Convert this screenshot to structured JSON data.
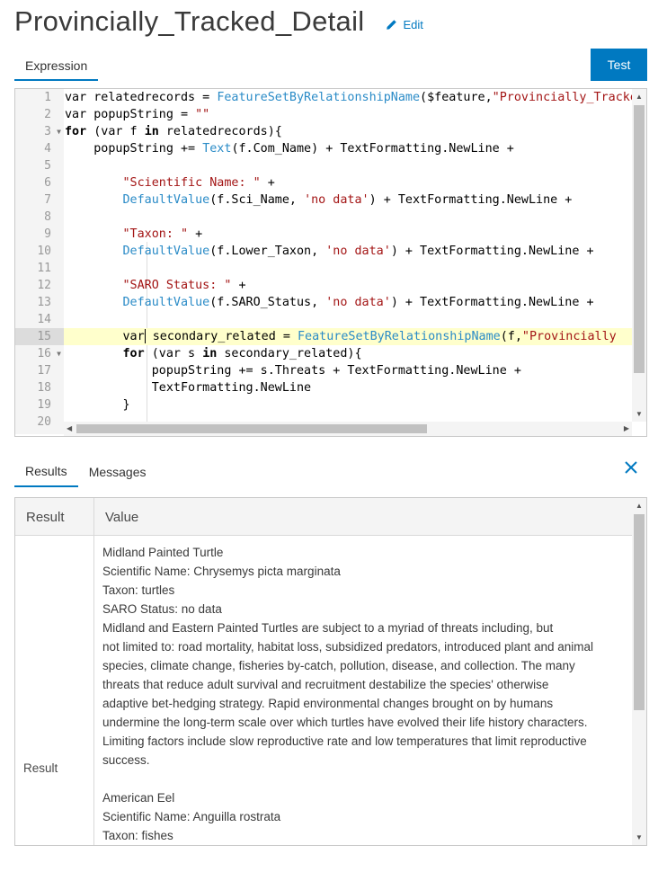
{
  "header": {
    "title": "Provincially_Tracked_Detail",
    "edit_label": "Edit"
  },
  "editor_tab": "Expression",
  "test_label": "Test",
  "code": {
    "line_numbers": [
      "1",
      "2",
      "3",
      "4",
      "5",
      "6",
      "7",
      "8",
      "9",
      "10",
      "11",
      "12",
      "13",
      "14",
      "15",
      "16",
      "17",
      "18",
      "19",
      "20"
    ],
    "active_line": 15
  },
  "bottom_tabs": [
    "Results",
    "Messages"
  ],
  "results": {
    "columns": [
      "Result",
      "Value"
    ],
    "row_label": "Result",
    "lines": [
      "Midland Painted Turtle",
      "Scientific Name: Chrysemys picta marginata",
      "Taxon: turtles",
      "SARO Status: no data",
      "Midland and Eastern Painted Turtles are subject to a myriad of threats including, but",
      "not limited to: road mortality, habitat loss, subsidized predators, introduced plant and animal",
      "species, climate change, fisheries by-catch, pollution, disease, and collection. The many",
      "threats that reduce adult survival and recruitment destabilize the species' otherwise",
      "adaptive bet-hedging strategy. Rapid environmental changes brought on by humans",
      "undermine the long-term scale over which turtles have evolved their life history characters.",
      "Limiting factors include slow reproductive rate and low temperatures that limit reproductive",
      "success.",
      "",
      "American Eel",
      "Scientific Name: Anguilla rostrata",
      "Taxon: fishes"
    ]
  },
  "colors": {
    "accent": "#0079c1",
    "function": "#2a8bc7",
    "string": "#a31515",
    "active_line": "#ffffcc"
  },
  "icons": {
    "edit": "pencil-icon",
    "close": "close-icon"
  }
}
